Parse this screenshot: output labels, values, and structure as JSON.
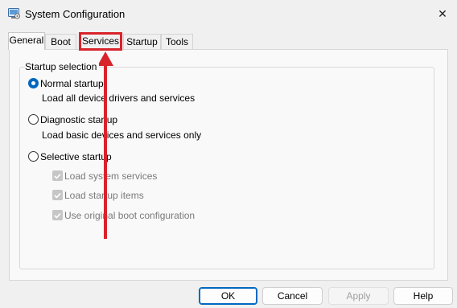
{
  "window": {
    "title": "System Configuration",
    "icon": "msconfig-icon",
    "close_glyph": "✕"
  },
  "tabs": [
    {
      "label": "General",
      "active": true
    },
    {
      "label": "Boot",
      "active": false
    },
    {
      "label": "Services",
      "active": false,
      "highlighted": true
    },
    {
      "label": "Startup",
      "active": false
    },
    {
      "label": "Tools",
      "active": false
    }
  ],
  "startup_selection": {
    "group_label": "Startup selection",
    "options": [
      {
        "label": "Normal startup",
        "description": "Load all device drivers and services",
        "selected": true
      },
      {
        "label": "Diagnostic startup",
        "description": "Load basic devices and services only",
        "selected": false
      },
      {
        "label": "Selective startup",
        "selected": false
      }
    ],
    "selective_items": [
      {
        "label": "Load system services",
        "checked": true,
        "disabled": true
      },
      {
        "label": "Load startup items",
        "checked": true,
        "disabled": true
      },
      {
        "label": "Use original boot configuration",
        "checked": true,
        "disabled": true
      }
    ]
  },
  "buttons": {
    "ok": "OK",
    "cancel": "Cancel",
    "apply": "Apply",
    "help": "Help"
  },
  "colors": {
    "accent": "#0067c0",
    "annotation": "#d9232b"
  }
}
